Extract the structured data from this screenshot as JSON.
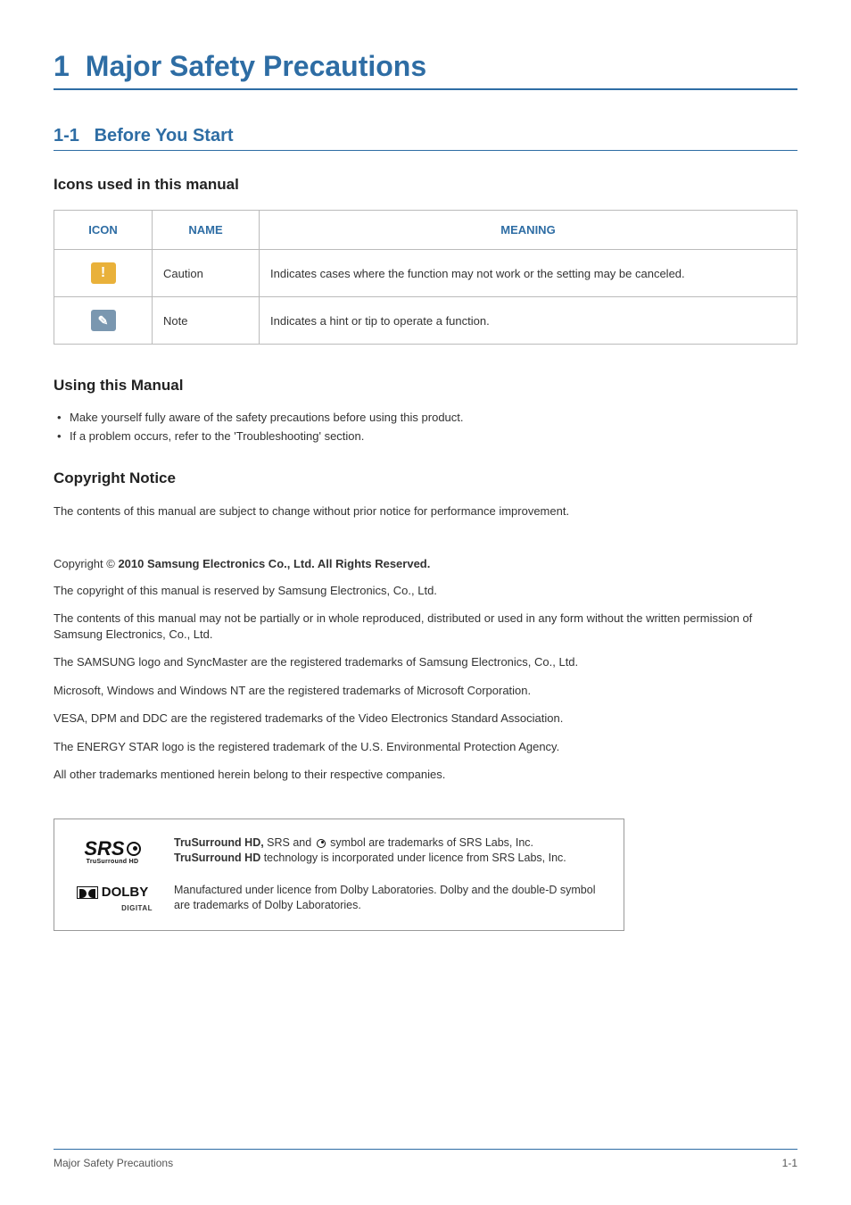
{
  "chapter": {
    "number": "1",
    "title": "Major Safety Precautions"
  },
  "section": {
    "number": "1-1",
    "title": "Before You Start"
  },
  "icons_section": {
    "heading": "Icons used in this manual",
    "headers": {
      "icon": "ICON",
      "name": "NAME",
      "meaning": "MEANING"
    },
    "rows": [
      {
        "glyph": "!",
        "name": "Caution",
        "meaning": "Indicates cases where the function may not work or the setting may be canceled."
      },
      {
        "glyph": "✎",
        "name": "Note",
        "meaning": "Indicates a hint or tip to operate a function."
      }
    ]
  },
  "using_manual": {
    "heading": "Using this Manual",
    "items": [
      "Make yourself fully aware of the safety precautions before using this product.",
      "If a problem occurs, refer to the 'Troubleshooting' section."
    ]
  },
  "copyright": {
    "heading": "Copyright Notice",
    "intro": "The contents of this manual are subject to change without prior notice for performance improvement.",
    "line_prefix": "Copyright © ",
    "line_bold": "2010 Samsung Electronics Co., Ltd. All Rights Reserved.",
    "paras": [
      "The copyright of this manual is reserved by Samsung Electronics, Co., Ltd.",
      "The contents of this manual may not be partially or in whole reproduced, distributed or used in any form without the written permission of Samsung Electronics, Co., Ltd.",
      "The SAMSUNG logo and SyncMaster are the registered trademarks of Samsung Electronics, Co., Ltd.",
      "Microsoft, Windows and Windows NT are the registered trademarks of Microsoft Corporation.",
      "VESA, DPM and DDC are the registered trademarks of the Video Electronics Standard Association.",
      "The ENERGY STAR logo is the registered trademark of the U.S. Environmental Protection Agency.",
      "All other trademarks mentioned herein belong to their respective companies."
    ]
  },
  "logos": {
    "srs": {
      "brand": "SRS",
      "sub": "TruSurround HD",
      "line1_a": "TruSurround HD,",
      "line1_b": " SRS and ",
      "line1_c": " symbol are trademarks of SRS Labs, Inc.",
      "line2_a": "TruSurround HD",
      "line2_b": " technology is incorporated under licence from SRS Labs, Inc."
    },
    "dolby": {
      "brand": "DOLBY",
      "sub": "DIGITAL",
      "text": "Manufactured under licence from Dolby Laboratories. Dolby and the double-D symbol are trademarks of Dolby Laboratories."
    }
  },
  "footer": {
    "left": "Major Safety Precautions",
    "right": "1-1"
  }
}
